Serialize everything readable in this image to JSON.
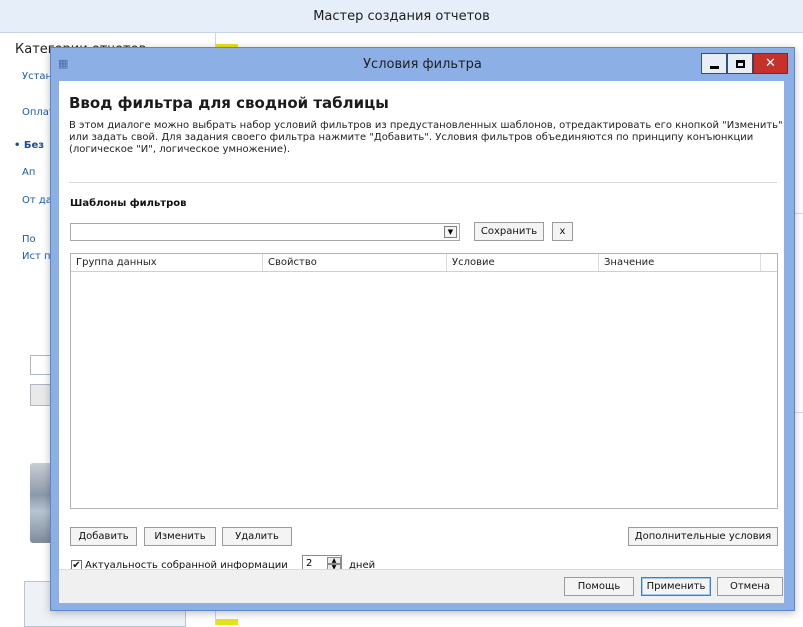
{
  "background": {
    "window_title": "Мастер создания отчетов",
    "categories_title": "Категории отчетов",
    "categories": [
      {
        "label": "Установка запуск",
        "active": false
      },
      {
        "label": "Оплата Учет",
        "active": false
      },
      {
        "label": "Без",
        "active": true
      },
      {
        "label": "Ап",
        "active": false
      },
      {
        "label": "От данные",
        "active": false
      },
      {
        "label": "По",
        "active": false
      },
      {
        "label": "Ист пер",
        "active": false
      }
    ]
  },
  "dialog": {
    "title": "Условия фильтра",
    "heading": "Ввод фильтра для сводной таблицы",
    "description": "В этом диалоге можно выбрать набор условий фильтров из предустановленных шаблонов, отредактировать его кнопкой \"Изменить\" или задать свой. Для задания своего фильтра нажмите \"Добавить\". Условия фильтров объединяются по принципу конъюнкции (логическое \"И\", логическое умножение).",
    "templates_label": "Шаблоны фильтров",
    "template_value": "",
    "save_label": "Сохранить",
    "clear_label": "x",
    "columns": [
      "Группа данных",
      "Свойство",
      "Условие",
      "Значение"
    ],
    "add_label": "Добавить",
    "edit_label": "Изменить",
    "delete_label": "Удалить",
    "extra_conditions_label": "Дополнительные условия",
    "actuality_checked": true,
    "actuality_label": "Актуальность собранной информации",
    "days_value": "2",
    "days_unit": "дней",
    "help_label": "Помощь",
    "apply_label": "Применить",
    "cancel_label": "Отмена"
  },
  "colors": {
    "dialog_frame": "#8cb0e6",
    "close_button": "#c7312c",
    "link": "#1a5bb0"
  }
}
